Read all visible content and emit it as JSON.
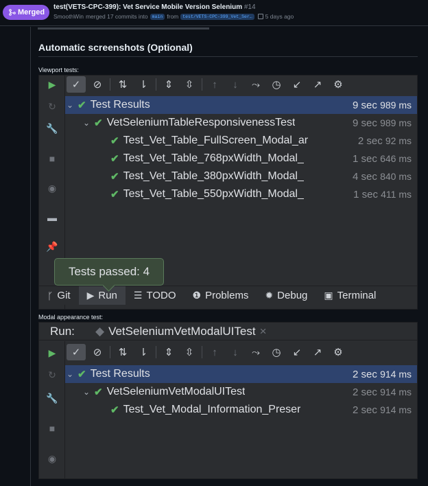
{
  "header": {
    "status": "Merged",
    "title": "test(VETS-CPC-399): Vet Service Mobile Version Selenium",
    "number": "#14",
    "author": "SmoothWin",
    "merge_text": "merged 17 commits into",
    "base_branch": "main",
    "from": "from",
    "head_branch": "test/VETS-CPC-399_Vet_Ser…",
    "time": "5 days ago"
  },
  "body": {
    "heading": "Automatic screenshots (Optional)",
    "viewport_label": "Viewport tests:",
    "modal_label": "Modal appearance test:"
  },
  "shot1": {
    "rows": [
      {
        "name": "Test Results",
        "time": "9 sec",
        "ms": "989 ms"
      },
      {
        "name": "VetSeleniumTableResponsivenessTest",
        "time": "9 sec",
        "ms": "989 ms"
      },
      {
        "name": "Test_Vet_Table_FullScreen_Modal_ar",
        "time": "2 sec",
        "ms": "92 ms"
      },
      {
        "name": "Test_Vet_Table_768pxWidth_Modal_",
        "time": "1 sec",
        "ms": "646 ms"
      },
      {
        "name": "Test_Vet_Table_380pxWidth_Modal_",
        "time": "4 sec",
        "ms": "840 ms"
      },
      {
        "name": "Test_Vet_Table_550pxWidth_Modal_",
        "time": "1 sec",
        "ms": "411 ms"
      }
    ],
    "tooltip": "Tests passed: 4",
    "tabs": [
      "Git",
      "Run",
      "TODO",
      "Problems",
      "Debug",
      "Terminal"
    ]
  },
  "shot2": {
    "run_label": "Run:",
    "run_tab": "VetSeleniumVetModalUITest",
    "rows": [
      {
        "name": "Test Results",
        "time": "2 sec",
        "ms": "914 ms"
      },
      {
        "name": "VetSeleniumVetModalUITest",
        "time": "2 sec",
        "ms": "914 ms"
      },
      {
        "name": "Test_Vet_Modal_Information_Preser",
        "time": "2 sec",
        "ms": "914 ms"
      }
    ]
  },
  "colors": {
    "merged": "#8957e5",
    "pass": "#5fb865",
    "selected": "#2e436e"
  }
}
